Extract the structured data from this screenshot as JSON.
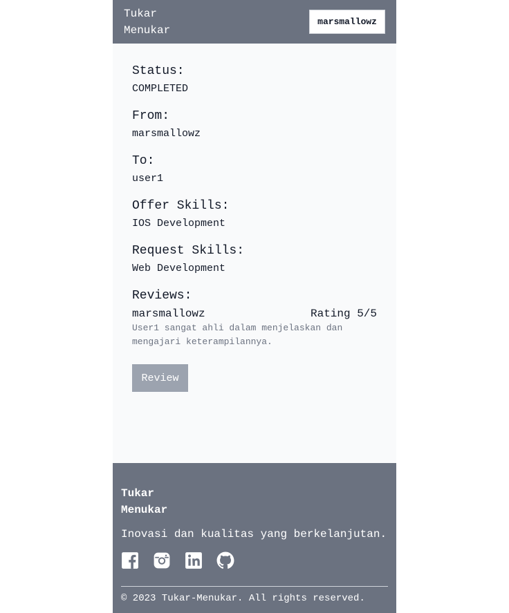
{
  "header": {
    "logo_line1": "Tukar",
    "logo_line2": "Menukar",
    "user_button": "marsmallowz"
  },
  "details": {
    "status_label": "Status:",
    "status_value": "COMPLETED",
    "from_label": "From:",
    "from_value": "marsmallowz",
    "to_label": "To:",
    "to_value": "user1",
    "offer_label": "Offer Skills:",
    "offer_value": "IOS Development",
    "request_label": "Request Skills:",
    "request_value": "Web Development",
    "reviews_label": "Reviews:"
  },
  "reviews": [
    {
      "author": "marsmallowz",
      "rating": "Rating 5/5",
      "text": "User1 sangat ahli dalam menjelaskan dan mengajari keterampilannya."
    }
  ],
  "review_button": "Review",
  "footer": {
    "logo_line1": "Tukar",
    "logo_line2": "Menukar",
    "tagline": "Inovasi dan kualitas yang berkelanjutan.",
    "social_icons": [
      "facebook-icon",
      "instagram-icon",
      "linkedin-icon",
      "github-icon"
    ],
    "copyright": "© 2023 Tukar-Menukar. All rights reserved."
  }
}
